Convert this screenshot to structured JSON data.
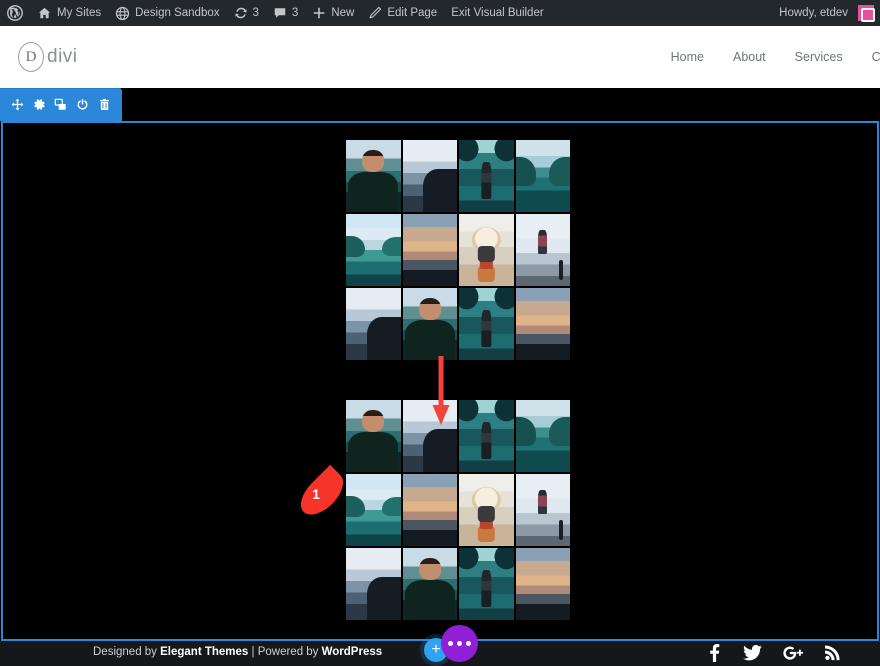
{
  "admin_bar": {
    "items": [
      {
        "icon": "wordpress-icon",
        "label": ""
      },
      {
        "icon": "my-sites-icon",
        "label": "My Sites"
      },
      {
        "icon": "site-icon",
        "label": "Design Sandbox"
      },
      {
        "icon": "updates-icon",
        "label": "3"
      },
      {
        "icon": "comments-icon",
        "label": "3"
      },
      {
        "icon": "plus-icon",
        "label": "New"
      },
      {
        "icon": "pencil-icon",
        "label": "Edit Page"
      },
      {
        "icon": "",
        "label": "Exit Visual Builder"
      }
    ],
    "howdy": "Howdy, etdev"
  },
  "header": {
    "logo_letter": "D",
    "logo_text": "divi",
    "nav": [
      "Home",
      "About",
      "Services",
      "Cont"
    ]
  },
  "builder": {
    "section_toolbar": [
      {
        "icon": "move-icon",
        "label": "Move Section"
      },
      {
        "icon": "gear-icon",
        "label": "Section Settings"
      },
      {
        "icon": "duplicate-icon",
        "label": "Duplicate Section"
      },
      {
        "icon": "power-icon",
        "label": "Disable Section"
      },
      {
        "icon": "trash-icon",
        "label": "Delete Section"
      }
    ],
    "accent_color": "#2b87da",
    "fab": {
      "add_label": "+",
      "menu_icon": "ellipsis-icon",
      "add_color": "#2ea3f2",
      "menu_color": "#8f20d6"
    }
  },
  "galleries": [
    {
      "name": "gallery-top",
      "tiles": [
        "photo-portrait-man-lake",
        "photo-misty-valley-cliff",
        "photo-man-standing-rock",
        "photo-teal-lake",
        "photo-blue-sky-lake",
        "photo-warm-sunset-water",
        "photo-person-with-camera",
        "photo-person-snowy-shore",
        "photo-misty-valley-cliff",
        "photo-portrait-man-lake",
        "photo-man-standing-rock",
        "photo-warm-sunset-water"
      ]
    },
    {
      "name": "gallery-bottom",
      "tiles": [
        "photo-portrait-man-lake",
        "photo-misty-valley-cliff",
        "photo-man-standing-rock",
        "photo-teal-lake",
        "photo-blue-sky-lake",
        "photo-warm-sunset-water",
        "photo-person-with-camera",
        "photo-person-snowy-shore",
        "photo-misty-valley-cliff",
        "photo-portrait-man-lake",
        "photo-man-standing-rock",
        "photo-warm-sunset-water"
      ]
    }
  ],
  "annotations": {
    "arrow": {
      "name": "red-down-arrow",
      "color": "#f4433a"
    },
    "badge": {
      "number": "1",
      "color": "#f6342a"
    }
  },
  "footer": {
    "credit_prefix": "Designed by ",
    "credit_brand1": "Elegant Themes",
    "credit_middle": " | Powered by ",
    "credit_brand2": "WordPress",
    "social": [
      "facebook-icon",
      "twitter-icon",
      "googleplus-icon",
      "rss-icon"
    ]
  }
}
